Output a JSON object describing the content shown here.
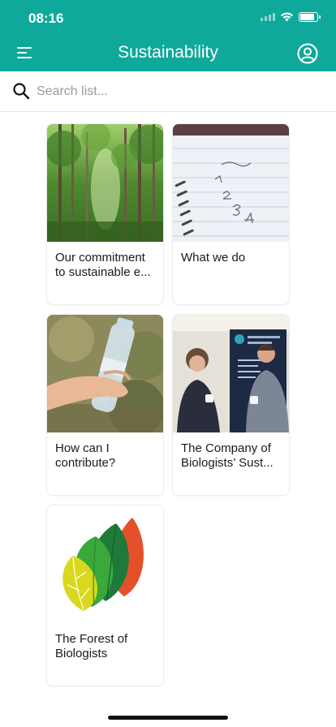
{
  "status_bar": {
    "time": "08:16",
    "battery_level": 0.9,
    "signal_icon": "signal-icon",
    "wifi_icon": "wifi-icon",
    "battery_icon": "battery-icon"
  },
  "header": {
    "title": "Sustainability",
    "menu_icon": "menu-icon",
    "profile_icon": "profile-icon",
    "background_color": "#0fa99b"
  },
  "search": {
    "placeholder": "Search list...",
    "value": "",
    "icon": "search-icon"
  },
  "cards": [
    {
      "title": "Our commitment to sustainable e...",
      "image": "forest-photo"
    },
    {
      "title": "What we do",
      "image": "notebook-photo"
    },
    {
      "title": "How can I contribute?",
      "image": "water-bottle-photo"
    },
    {
      "title": "The Company of Biologists’ Sust...",
      "image": "conference-photo"
    },
    {
      "title": "The Forest of Biologists",
      "image": "leaves-logo"
    }
  ]
}
